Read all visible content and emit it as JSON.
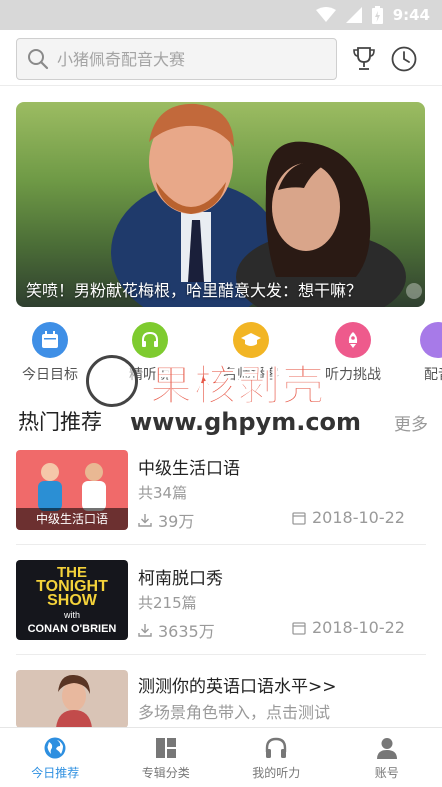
{
  "status_bar": {
    "time": "9:44"
  },
  "search": {
    "placeholder": "小猪佩奇配音大赛"
  },
  "banner": {
    "caption": "笑喷！男粉献花梅根，哈里醋意大发：想干嘛？"
  },
  "categories": [
    {
      "label": "今日目标",
      "icon": "calendar-icon",
      "color": "#3f8fe6"
    },
    {
      "label": "精听说",
      "icon": "headphones-icon",
      "color": "#7ecb2f"
    },
    {
      "label": "名师播客",
      "icon": "graduation-cap-icon",
      "color": "#f2b524"
    },
    {
      "label": "听力挑战",
      "icon": "rocket-icon",
      "color": "#ee5a8c"
    },
    {
      "label": "配音",
      "icon": "mic-icon",
      "color": "#a77ae8"
    }
  ],
  "watermark": {
    "cn": "果核剥壳",
    "url": "www.ghpym.com"
  },
  "section": {
    "title": "热门推荐",
    "more": "更多"
  },
  "list": [
    {
      "title": "中级生活口语",
      "count": "共34篇",
      "plays": "39万",
      "date": "2018-10-22",
      "thumb_label": "中级生活口语"
    },
    {
      "title": "柯南脱口秀",
      "count": "共215篇",
      "plays": "3635万",
      "date": "2018-10-22",
      "thumb_lines": [
        "THE",
        "TONIGHT",
        "SHOW",
        "with",
        "CONAN O'BRIEN"
      ]
    },
    {
      "title": "测测你的英语口语水平>>",
      "subtitle": "多场景角色带入，点击测试"
    }
  ],
  "bottom_nav": [
    {
      "label": "今日推荐",
      "icon": "globe-icon",
      "active": true
    },
    {
      "label": "专辑分类",
      "icon": "grid-icon",
      "active": false
    },
    {
      "label": "我的听力",
      "icon": "headphones-icon",
      "active": false
    },
    {
      "label": "账号",
      "icon": "user-icon",
      "active": false
    }
  ],
  "colors": {
    "accent": "#2d8fe0",
    "inactive": "#777777"
  }
}
